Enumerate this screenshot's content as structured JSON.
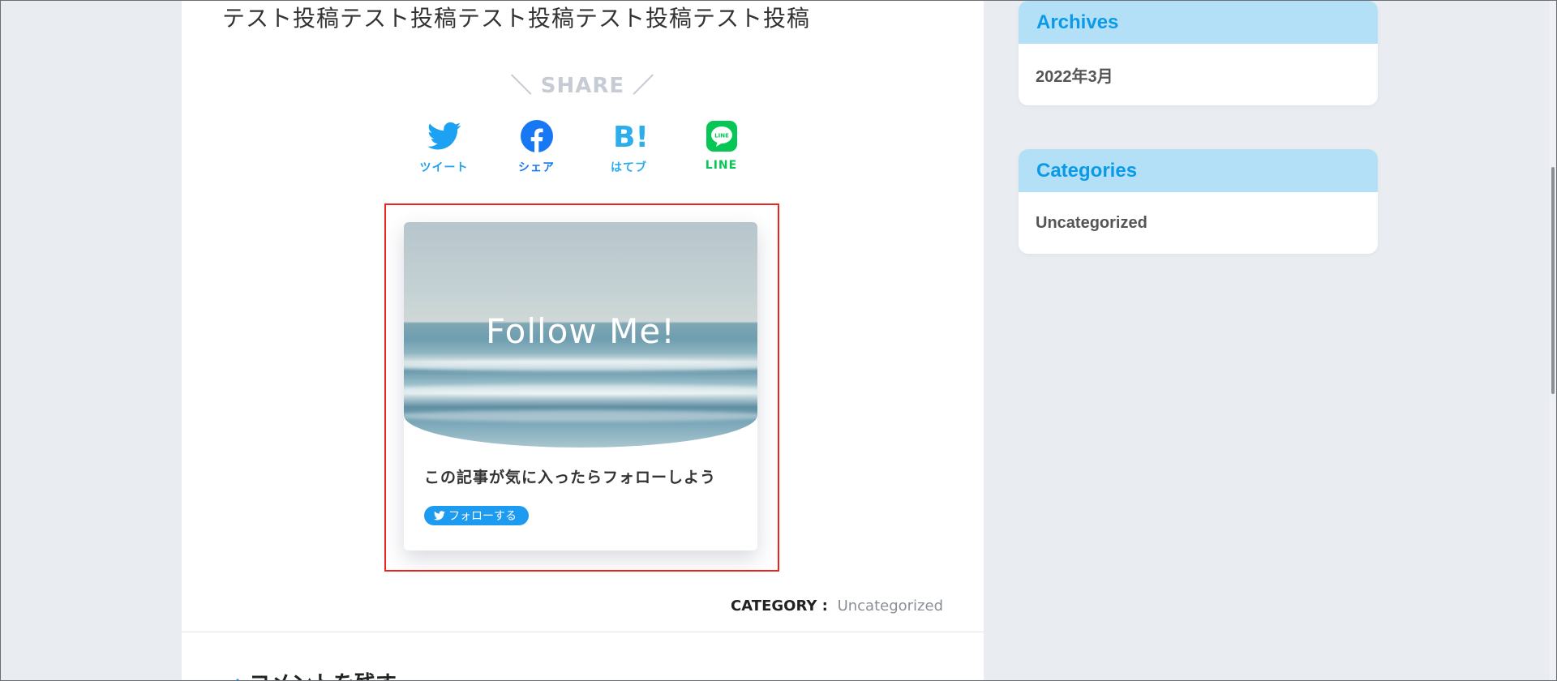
{
  "article": {
    "body_text": "テスト投稿テスト投稿テスト投稿テスト投稿テスト投稿"
  },
  "share": {
    "heading": "＼ SHARE ／",
    "buttons": [
      {
        "label": "ツイート",
        "icon": "twitter-icon",
        "color": "#1da1f2"
      },
      {
        "label": "シェア",
        "icon": "facebook-icon",
        "color": "#1877f2"
      },
      {
        "label": "はてブ",
        "icon": "hatena-bookmark-icon",
        "color": "#2caeed"
      },
      {
        "label": "LINE",
        "icon": "line-icon",
        "color": "#06c755"
      }
    ]
  },
  "follow_box": {
    "title": "Follow Me!",
    "message": "この記事が気に入ったらフォローしよう",
    "button_label": "フォローする",
    "button_color": "#1d9bf0",
    "highlight_color": "#e8261f"
  },
  "category": {
    "label": "CATEGORY :",
    "value": "Uncategorized"
  },
  "comments": {
    "heading": "コメントを残す"
  },
  "sidebar": {
    "accent_color": "#0a9be8",
    "header_bg": "#b3dff7",
    "widgets": [
      {
        "title": "Archives",
        "items": [
          "2022年3月"
        ]
      },
      {
        "title": "Categories",
        "items": [
          "Uncategorized"
        ]
      }
    ]
  },
  "line_icon_text": "LINE"
}
